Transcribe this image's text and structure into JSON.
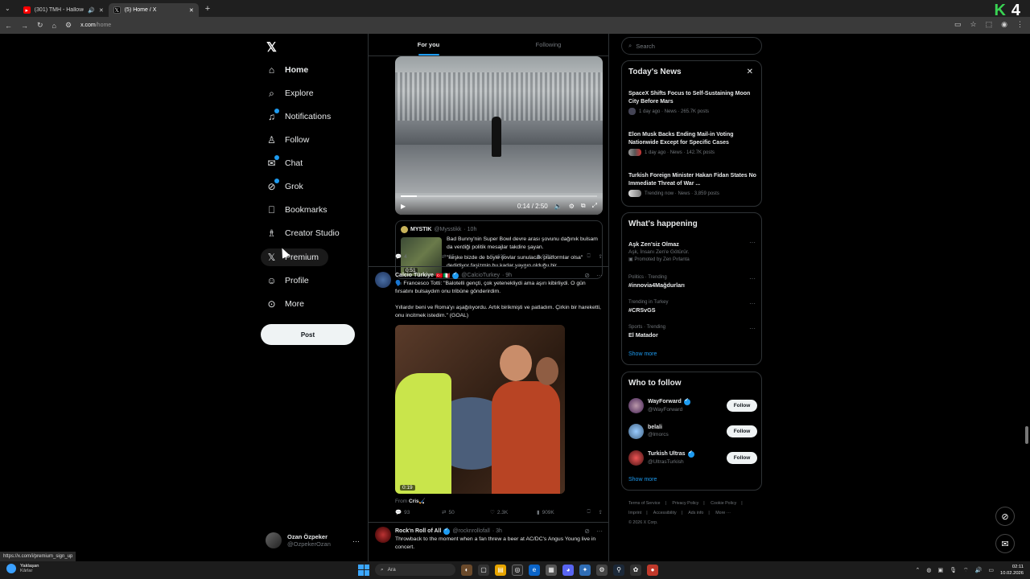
{
  "browser": {
    "tabs": [
      {
        "title": "(301) TMH - Halloween [G/…",
        "active": false
      },
      {
        "title": "(5) Home / X",
        "active": true
      }
    ],
    "url_host": "x.com",
    "url_path": "/home",
    "status_url": "https://x.com/i/premium_sign_up",
    "overlay_logo_k": "K",
    "overlay_logo_num": "4"
  },
  "nav": {
    "logo": "𝕏",
    "items": [
      {
        "label": "Home",
        "icon": "home-icon"
      },
      {
        "label": "Explore",
        "icon": "search-icon"
      },
      {
        "label": "Notifications",
        "icon": "bell-icon"
      },
      {
        "label": "Follow",
        "icon": "person-add-icon"
      },
      {
        "label": "Chat",
        "icon": "mail-icon"
      },
      {
        "label": "Grok",
        "icon": "grok-icon"
      },
      {
        "label": "Bookmarks",
        "icon": "bookmark-icon"
      },
      {
        "label": "Creator Studio",
        "icon": "creator-icon"
      },
      {
        "label": "Premium",
        "icon": "x-icon"
      },
      {
        "label": "Profile",
        "icon": "profile-icon"
      },
      {
        "label": "More",
        "icon": "more-icon"
      }
    ],
    "post_label": "Post",
    "account": {
      "name": "Ozan Özpeker",
      "handle": "@OzpekerOzan"
    }
  },
  "feed": {
    "tabs": [
      "For you",
      "Following"
    ],
    "video1": {
      "time": "0:14 / 2:50",
      "progress": 0.08
    },
    "quote": {
      "name": "MYSTIK",
      "handle": "@Mysstikk",
      "age": "· 10h",
      "duration": "0:51",
      "text1": "Bad Bunny'nin Super Bowl devre arası şovunu dağınık bulsam da verdiği politik mesajlar takdire şayan.",
      "text2": "\"keşke bizde de böyle şovlar sunulacak platformlar olsa\" dedirtiyor faşizmin bu kadar yaygın olduğu bir ..."
    },
    "actions1": {
      "replies": "4",
      "reposts": "15",
      "likes": "635",
      "views": "97K"
    },
    "tweet2": {
      "name": "Calcio Türkiye",
      "flags": "🇹🇷🇮🇹",
      "handle": "@CalcioTurkey",
      "age": "· 9h",
      "text1": "🗣️ Francesco Totti: \"Balotelli gençti, çok yetenekliydi ama aşırı kibirliydi. O gün fırsatını bulsaydım onu tribüne gönderirdim.",
      "text2": "Yıllardır beni ve Roma'yı aşağılıyordu. Artık birikmişti ve patladım. Çirkin bir hareketti, onu incitmek istedim.\" (GOAL)",
      "duration": "0:19",
      "from_label": "From",
      "from_name": "Cris🏑"
    },
    "actions2": {
      "replies": "93",
      "reposts": "50",
      "likes": "2.3K",
      "views": "909K"
    },
    "tweet3": {
      "name": "Rock'n Roll of All",
      "handle": "@rocknrollofall",
      "age": "· 3h",
      "text": "Throwback to the moment when a fan threw a beer at AC/DC's Angus Young live in concert."
    }
  },
  "right": {
    "search_placeholder": "Search",
    "todays_news": {
      "title": "Today's News",
      "items": [
        {
          "title": "SpaceX Shifts Focus to Self-Sustaining Moon City Before Mars",
          "meta": "1 day ago · News · 265.7K posts"
        },
        {
          "title": "Elon Musk Backs Ending Mail-in Voting Nationwide Except for Specific Cases",
          "meta": "1 day ago · News · 142.7K posts"
        },
        {
          "title": "Turkish Foreign Minister Hakan Fidan States No Immediate Threat of War ...",
          "meta": "Trending now · News · 3,859 posts"
        }
      ]
    },
    "whats_happening": {
      "title": "What's happening",
      "items": [
        {
          "category": "",
          "name": "Aşk Zen'siz Olmaz",
          "sub": "Aşk, İnsanı Zen'e Götürür.",
          "promo": "Promoted by Zen Pırlanta"
        },
        {
          "category": "Politics · Trending",
          "name": "#innovia4Mağdurları",
          "sub": "",
          "promo": ""
        },
        {
          "category": "Trending in Turkey",
          "name": "#CRSvGS",
          "sub": "",
          "promo": ""
        },
        {
          "category": "Sports · Trending",
          "name": "El Matador",
          "sub": "",
          "promo": ""
        }
      ],
      "show_more": "Show more"
    },
    "who_to_follow": {
      "title": "Who to follow",
      "items": [
        {
          "name": "WayForward",
          "handle": "@WayForward",
          "verified": true,
          "button": "Follow"
        },
        {
          "name": "belali",
          "handle": "@lmorcs",
          "verified": false,
          "button": "Follow"
        },
        {
          "name": "Turkish Ultras",
          "handle": "@UltrasTurkish",
          "verified": true,
          "button": "Follow"
        }
      ],
      "show_more": "Show more"
    },
    "footer": {
      "links": [
        "Terms of Service",
        "|",
        "Privacy Policy",
        "|",
        "Cookie Policy",
        "|",
        "Imprint",
        "|",
        "Accessibility",
        "|",
        "Ads info",
        "|",
        "More ···"
      ],
      "copyright": "© 2026 X Corp."
    }
  },
  "taskbar": {
    "weather_title": "Yaklaşan",
    "weather_sub": "Kârlar",
    "search_placeholder": "Ara",
    "time": "02:11",
    "date": "10.02.2026"
  }
}
